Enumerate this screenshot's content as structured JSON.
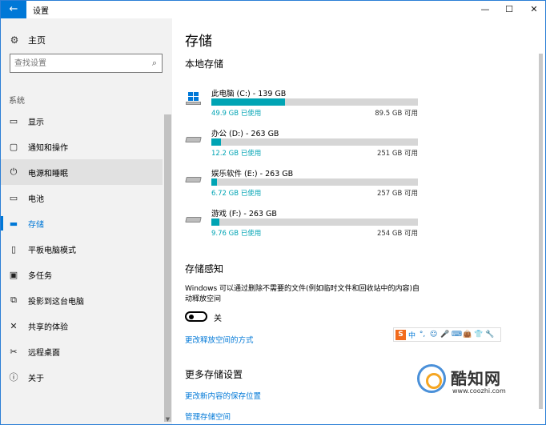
{
  "titlebar": {
    "back_icon": "←",
    "title": "设置",
    "minimize_icon": "—",
    "maximize_icon": "☐",
    "close_icon": "✕"
  },
  "sidebar": {
    "home": {
      "icon": "⚙",
      "label": "主页"
    },
    "search": {
      "placeholder": "查找设置",
      "icon": "⌕"
    },
    "category": "系统",
    "items": [
      {
        "icon": "▭",
        "label": "显示"
      },
      {
        "icon": "▢",
        "label": "通知和操作"
      },
      {
        "icon": "⏻",
        "label": "电源和睡眠"
      },
      {
        "icon": "▭",
        "label": "电池"
      },
      {
        "icon": "▬",
        "label": "存储"
      },
      {
        "icon": "▯",
        "label": "平板电脑模式"
      },
      {
        "icon": "▣",
        "label": "多任务"
      },
      {
        "icon": "⧉",
        "label": "投影到这台电脑"
      },
      {
        "icon": "✕",
        "label": "共享的体验"
      },
      {
        "icon": "✂",
        "label": "远程桌面"
      },
      {
        "icon": "ⓘ",
        "label": "关于"
      }
    ],
    "hovered_index": 2,
    "active_index": 4,
    "scroll_down_icon": "▼"
  },
  "main": {
    "title": "存储",
    "local_storage_heading": "本地存储",
    "drives": [
      {
        "name": "此电脑 (C:) - 139 GB",
        "used": "49.9 GB 已使用",
        "free": "89.5 GB 可用",
        "used_fraction": 0.358,
        "icon": "windows-drive"
      },
      {
        "name": "办公 (D:) - 263 GB",
        "used": "12.2 GB 已使用",
        "free": "251 GB 可用",
        "used_fraction": 0.046,
        "icon": "hard-drive"
      },
      {
        "name": "娱乐软件 (E:) - 263 GB",
        "used": "6.72 GB 已使用",
        "free": "257 GB 可用",
        "used_fraction": 0.026,
        "icon": "hard-drive"
      },
      {
        "name": "游戏 (F:) - 263 GB",
        "used": "9.76 GB 已使用",
        "free": "254 GB 可用",
        "used_fraction": 0.037,
        "icon": "hard-drive"
      }
    ],
    "storage_sense_heading": "存储感知",
    "storage_sense_desc": "Windows 可以通过删除不需要的文件(例如临时文件和回收站中的内容)自动释放空间",
    "toggle_label": "关",
    "toggle_on": false,
    "change_free_space_link": "更改释放空间的方式",
    "more_settings_heading": "更多存储设置",
    "change_save_location_link": "更改新内容的保存位置",
    "manage_spaces_link": "管理存储空间"
  },
  "ime_toolbar": {
    "logo": "S",
    "mode": "中",
    "icons": [
      "°,",
      "☺",
      "🎤",
      "⌨",
      "👜",
      "👕",
      "🔧"
    ]
  },
  "watermark": {
    "brand": "酷知网",
    "url": "www.coozhi.com"
  },
  "colors": {
    "accent": "#0078d7",
    "bar_fill": "#00a4b4",
    "bar_track": "#d6d6d6",
    "sidebar_bg": "#f2f2f2"
  }
}
